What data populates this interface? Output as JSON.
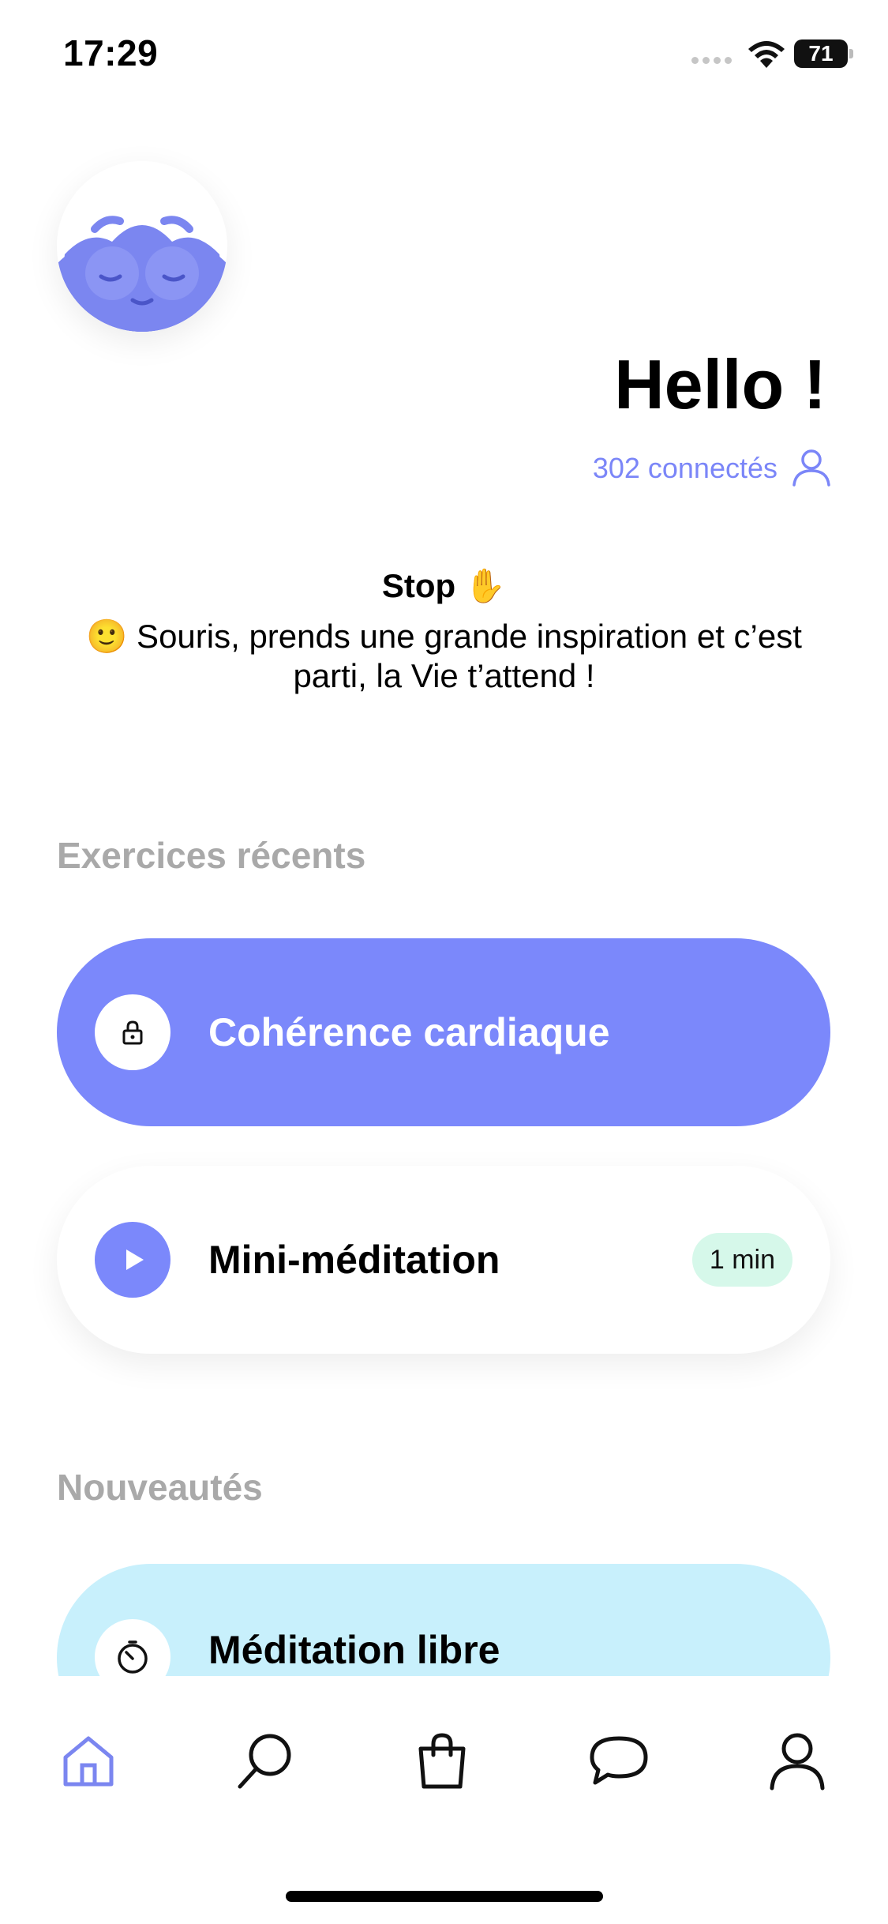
{
  "status_bar": {
    "time": "17:29",
    "battery": "71"
  },
  "header": {
    "greeting": "Hello !",
    "online_count": "302 connectés"
  },
  "quote": {
    "title": "Stop ✋",
    "text": "🙂 Souris, prends une grande inspiration et c’est parti, la Vie t’attend !"
  },
  "recent": {
    "title": "Exercices récents",
    "items": [
      {
        "label": "Cohérence cardiaque",
        "icon": "lock-icon",
        "locked": true
      },
      {
        "label": "Mini-méditation",
        "icon": "play-icon",
        "duration": "1 min"
      }
    ]
  },
  "new": {
    "title": "Nouveautés",
    "items": [
      {
        "label": "Méditation libre",
        "icon": "timer-icon"
      }
    ]
  },
  "tab_bar": {
    "items": [
      "home-icon",
      "search-icon",
      "shop-bag-icon",
      "chat-icon",
      "profile-icon"
    ],
    "active": "home-icon"
  },
  "colors": {
    "accent": "#7b88fb",
    "badge_bg": "#d6f8ea",
    "new_card_bg": "#c8f0fc",
    "section_title": "#a9a9a9"
  }
}
